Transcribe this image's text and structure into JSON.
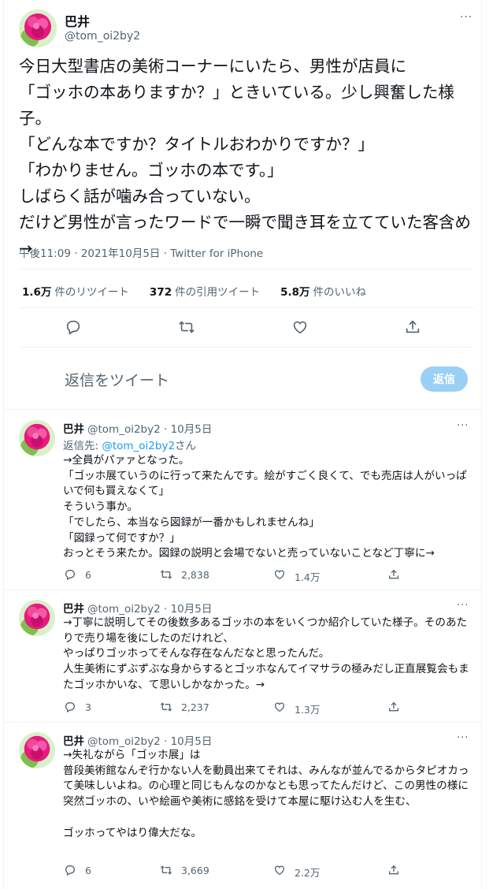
{
  "main": {
    "name": "巴井",
    "handle": "@tom_oi2by2",
    "text": "今日大型書店の美術コーナーにいたら、男性が店員に\n「ゴッホの本ありますか？」ときいている。少し興奮した様子。\n「どんな本ですか？タイトルおわかりですか？」\n「わかりません。ゴッホの本です。」\nしばらく話が噛み合っていない。\nだけど男性が言ったワードで一瞬で聞き耳を立てていた客含め→",
    "meta": "午後11:09 · 2021年10月5日 · Twitter for iPhone",
    "stats": [
      {
        "value": "1.6万",
        "label": "件のリツイート"
      },
      {
        "value": "372",
        "label": "件の引用ツイート"
      },
      {
        "value": "5.8万",
        "label": "件のいいね"
      }
    ]
  },
  "compose": {
    "placeholder": "返信をツイート",
    "button": "返信"
  },
  "replies": [
    {
      "name": "巴井",
      "handle": "@tom_oi2by2",
      "date": "10月5日",
      "reply_to_label": "返信先: ",
      "reply_to_handle": "@tom_oi2by2",
      "reply_to_suffix": "さん",
      "text": "→全員がパァァとなった。\n「ゴッホ展ていうのに行って来たんです。絵がすごく良くて、でも売店は人がいっぱいで何も買えなくて」\nそういう事か。\n「でしたら、本当なら図録が一番かもしれませんね」\n「図録って何ですか？」\nおっとそう来たか。図録の説明と会場でないと売っていないことなど丁寧に→",
      "replies": "6",
      "retweets": "2,838",
      "likes": "1.4万"
    },
    {
      "name": "巴井",
      "handle": "@tom_oi2by2",
      "date": "10月5日",
      "text": "→丁寧に説明してその後数多あるゴッホの本をいくつか紹介していた様子。そのあたりで売り場を後にしたのだけれど、\nやっぱりゴッホってそんな存在なんだなと思ったんだ。\n人生美術にずぶずぶな身からするとゴッホなんてイマサラの極みだし正直展覧会もまたゴッホかいな、て思いしかなかった。→",
      "replies": "3",
      "retweets": "2,237",
      "likes": "1.3万"
    },
    {
      "name": "巴井",
      "handle": "@tom_oi2by2",
      "date": "10月5日",
      "text": "→失礼ながら「ゴッホ展」は\n普段美術館なんぞ行かない人を動員出来てそれは、みんなが並んでるからタピオカって美味しいよね。の心理と同じもんなのかなとも思ってたんだけど、この男性の様に突然ゴッホの、いや絵画や美術に感銘を受けて本屋に駆け込む人を生む、\n\nゴッホってやはり偉大だな。",
      "replies": "6",
      "retweets": "3,669",
      "likes": "2.2万"
    }
  ],
  "icons": {
    "reply": "reply-icon",
    "retweet": "retweet-icon",
    "like": "heart-icon",
    "share": "share-icon",
    "more": "more-icon"
  },
  "more_glyph": "···",
  "colors": {
    "accent": "#1d9bf0",
    "reply_button": "#9ad0f5",
    "secondary_text": "#536471",
    "avatar_flower": "#e8197f"
  }
}
